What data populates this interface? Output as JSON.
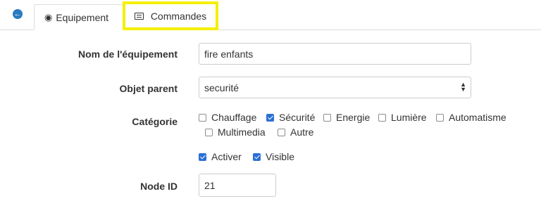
{
  "tabs": {
    "back_icon": "arrow-left-icon",
    "equipement": {
      "label": "Equipement",
      "icon": "dashboard-icon"
    },
    "commandes": {
      "label": "Commandes",
      "icon": "list-icon"
    }
  },
  "form": {
    "name": {
      "label": "Nom de l'équipement",
      "value": "fire enfants"
    },
    "parent": {
      "label": "Objet parent",
      "value": "securité"
    },
    "category": {
      "label": "Catégorie",
      "options": [
        {
          "label": "Chauffage",
          "checked": false
        },
        {
          "label": "Sécurité",
          "checked": true
        },
        {
          "label": "Energie",
          "checked": false
        },
        {
          "label": "Lumière",
          "checked": false
        },
        {
          "label": "Automatisme",
          "checked": false
        },
        {
          "label": "Multimedia",
          "checked": false
        },
        {
          "label": "Autre",
          "checked": false
        }
      ]
    },
    "activer": {
      "label": "Activer",
      "checked": true
    },
    "visible": {
      "label": "Visible",
      "checked": true
    },
    "node": {
      "label": "Node ID",
      "value": "21"
    }
  },
  "colors": {
    "accent": "#2c6fd6",
    "highlight": "#f5ef00",
    "back": "#2a7ac0"
  }
}
